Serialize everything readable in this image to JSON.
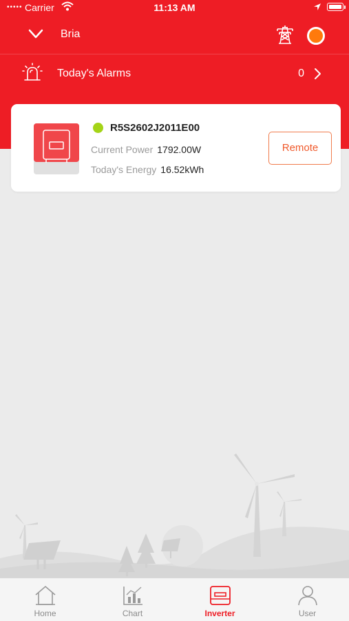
{
  "status_bar": {
    "signal": "•••••",
    "carrier": "Carrier",
    "time": "11:13 AM"
  },
  "header": {
    "station_name": "Bria",
    "status_color": "#ff7a0c",
    "brand_color": "#ee1d25"
  },
  "alarms": {
    "label": "Today's Alarms",
    "count": "0"
  },
  "inverter": {
    "serial": "R5S2602J2011E00",
    "online_color": "#a4d417",
    "power_label": "Current Power",
    "power_value": "1792.00W",
    "energy_label": "Today's Energy",
    "energy_value": "16.52kWh",
    "remote_label": "Remote"
  },
  "tabbar": {
    "tabs": [
      {
        "label": "Home",
        "icon": "home-icon"
      },
      {
        "label": "Chart",
        "icon": "chart-icon"
      },
      {
        "label": "Inverter",
        "icon": "inverter-icon",
        "active": true
      },
      {
        "label": "User",
        "icon": "user-icon"
      }
    ]
  }
}
